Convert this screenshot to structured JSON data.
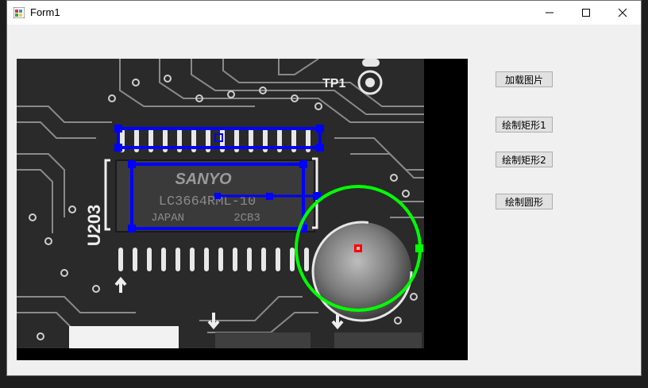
{
  "window": {
    "title": "Form1"
  },
  "controls": {
    "minimize": "—",
    "maximize": "☐",
    "close": "✕"
  },
  "buttons": {
    "load_image": "加载图片",
    "draw_rect1": "绘制矩形1",
    "draw_rect2": "绘制矩形2",
    "draw_circle": "绘制圆形"
  },
  "pcb_labels": {
    "brand": "SANYO",
    "part": "LC3664RML-10",
    "origin": "JAPAN",
    "code": "2CB3",
    "ref": "U203",
    "tp1": "TP1"
  },
  "colors": {
    "rect_color": "#0000ff",
    "circle_color": "#00ff00",
    "center_color": "#ff0000"
  }
}
